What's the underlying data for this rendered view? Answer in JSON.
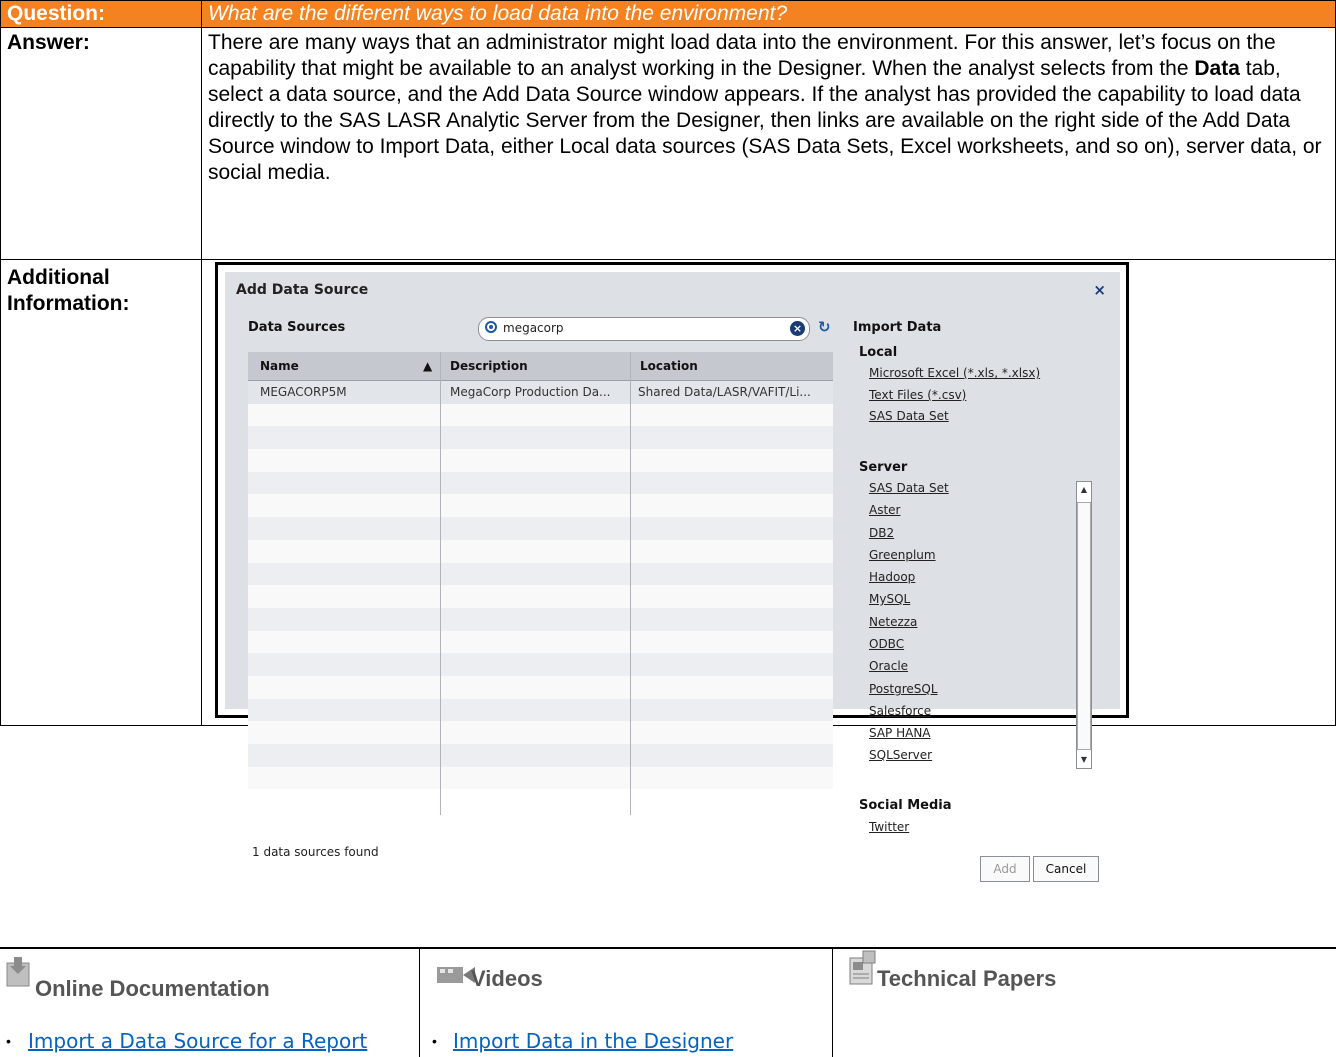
{
  "faq": {
    "question_label": "Question:",
    "question": "What are the different ways to load data into the environment?",
    "answer_label": "Answer:",
    "answer_parts": [
      "There are many ways that an administrator might load data into the environment. For this answer, let’s focus on the capability that might be available to an analyst working in the Designer. When the analyst selects from the ",
      "Data",
      " tab, select a data source, and the Add Data Source window appears. If the analyst has provided the capability to load data directly to the SAS LASR Analytic Server from the Designer, then links are available on the right side of the Add Data Source window to Import Data, either Local data sources (SAS Data Sets, Excel worksheets, and so on), server data, or social media."
    ],
    "additional_label_1": "Additional",
    "additional_label_2": "Information:"
  },
  "dialog": {
    "title": "Add Data Source",
    "close": "×",
    "data_sources_label": "Data Sources",
    "search_value": "megacorp",
    "columns": [
      "Name",
      "Description",
      "Location"
    ],
    "sort_indicator": "▲",
    "rows": [
      {
        "name": "MEGACORP5M",
        "description": "MegaCorp Production Da...",
        "location": "Shared Data/LASR/VAFIT/Li..."
      }
    ],
    "found_text": "1 data sources found",
    "import_title": "Import Data",
    "local_label": "Local",
    "local_links": [
      "Microsoft Excel (*.xls, *.xlsx)",
      "Text Files (*.csv)",
      "SAS Data Set"
    ],
    "server_label": "Server",
    "server_links": [
      "SAS Data Set",
      "Aster",
      "DB2",
      "Greenplum",
      "Hadoop",
      "MySQL",
      "Netezza",
      "ODBC",
      "Oracle",
      "PostgreSQL",
      "Salesforce",
      "SAP HANA",
      "SQLServer"
    ],
    "social_label": "Social Media",
    "social_links": [
      "Twitter"
    ],
    "add_button": "Add",
    "cancel_button": "Cancel"
  },
  "resources": {
    "online_doc": {
      "title": "Online Documentation",
      "link": "Import a Data Source for a Report"
    },
    "videos": {
      "title": "Videos",
      "link": "Import Data in the Designer"
    },
    "papers": {
      "title": "Technical Papers"
    }
  }
}
